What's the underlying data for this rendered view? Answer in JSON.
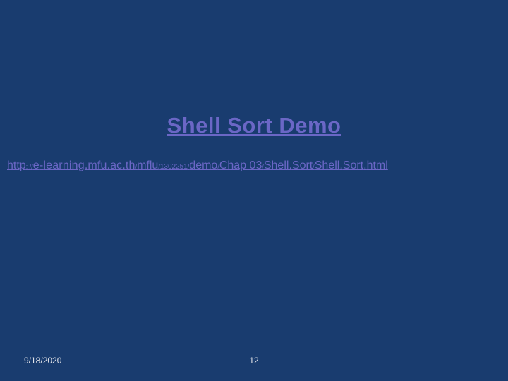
{
  "slide": {
    "title": "Shell Sort Demo",
    "link": {
      "scheme": "http",
      "sep1": ": //",
      "host1": "e",
      "hyphen": "-",
      "host2": "learning",
      "dot": ".",
      "host3": "mfu",
      "host4": "ac",
      "host5": "th",
      "slash": "/",
      "path1": "mflu",
      "num": "1302251",
      "path2": "demo",
      "path3": "Chap 03",
      "path4": "Shell",
      "pathDot": ".",
      "path5": "Sort",
      "path6": "Shell",
      "path7": "Sort",
      "path8": "html"
    },
    "footer": {
      "date": "9/18/2020",
      "page": "12"
    }
  }
}
